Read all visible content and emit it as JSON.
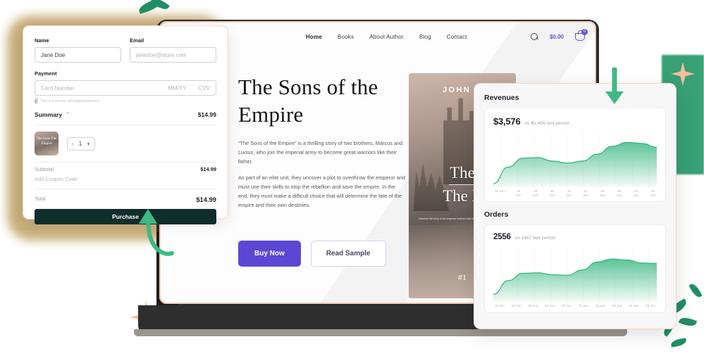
{
  "checkout": {
    "name_label": "Name",
    "name_value": "Jane Doe",
    "email_label": "Email",
    "email_placeholder": "janedoe@store.com",
    "payment_label": "Payment",
    "card_placeholder": "Card Number",
    "card_expiry_placeholder": "MM/YY",
    "card_cvv_placeholder": "CVV",
    "secure_note": "This is a secure, encrypted payment",
    "summary_label": "Summary",
    "summary_amount": "$14.99",
    "item_thumb_title": "The Sons\nThe Empire",
    "qty_minus": "-",
    "qty_value": "1",
    "qty_plus": "+",
    "subtotal_label": "Subtotal",
    "subtotal_value": "$14.99",
    "coupon_label": "Add Coupon Code",
    "total_label": "Total",
    "total_value": "$14.99",
    "purchase_label": "Purchase"
  },
  "site": {
    "nav": [
      {
        "label": "Home",
        "active": true
      },
      {
        "label": "Books",
        "active": false
      },
      {
        "label": "About Author",
        "active": false
      },
      {
        "label": "Blog",
        "active": false
      },
      {
        "label": "Contact",
        "active": false
      }
    ],
    "cart_price": "$0.00",
    "cart_count": "0",
    "hero_title": "The Sons of the Empire",
    "hero_p1": "“The Sons of the Empire” is a thrilling story of two brothers, Marcus and Lucius, who join the imperial army to become great warriors like their father.",
    "hero_p2": "As part of an elite unit, they uncover a plot to overthrow the emperor and must use their skills to stop the rebellion and save the empire. In the end, they must make a difficult choice that will determine the fate of the empire and their own destinies.",
    "buy_label": "Buy Now",
    "sample_label": "Read Sample",
    "cover_author": "JOHN D",
    "cover_title_line1": "The",
    "cover_title_line2": "The E",
    "cover_sub": "Discover the story of two imperial brothers who must make the hardest choice",
    "cover_rank": "#1"
  },
  "dashboard": {
    "revenues_heading": "Revenues",
    "orders_heading": "Orders"
  },
  "chart_data": [
    {
      "type": "area",
      "title": "Revenues",
      "value": "$3,576",
      "comparison": "vs $1,456 last period",
      "xlabel": "",
      "ylabel": "",
      "grid": true,
      "legend": "none",
      "categories": [
        "15 Jun",
        "18\nJun",
        "18\nJun",
        "18\nJun",
        "18\nJun",
        "18\nJun",
        "18\nJun",
        "18\nJun",
        "18\nJun",
        "18\nJun"
      ],
      "values": [
        4,
        38,
        56,
        57,
        50,
        46,
        50,
        64,
        80,
        88,
        86,
        78
      ],
      "ylim": [
        0,
        100
      ],
      "series_color": "#3fb985"
    },
    {
      "type": "area",
      "title": "Orders",
      "value": "2556",
      "comparison": "vs 1467 last period",
      "xlabel": "",
      "ylabel": "",
      "grid": true,
      "legend": "none",
      "categories": [
        "15 Jun",
        "18 Jun",
        "18 Jun",
        "18 Jun",
        "18 Jun",
        "18 Jun",
        "18 Jun",
        "18 Jun",
        "18 Jun",
        "18 Jun"
      ],
      "values": [
        12,
        40,
        55,
        56,
        52,
        51,
        62,
        78,
        84,
        82,
        76,
        75
      ],
      "ylim": [
        0,
        100
      ],
      "series_color": "#3fb985"
    }
  ],
  "colors": {
    "accent_purple": "#5b47d4",
    "accent_green": "#3fb985",
    "dark_button": "#0f2e2b",
    "card_border_peach": "#f6d6c4",
    "star_peach": "#f6bf9e"
  }
}
